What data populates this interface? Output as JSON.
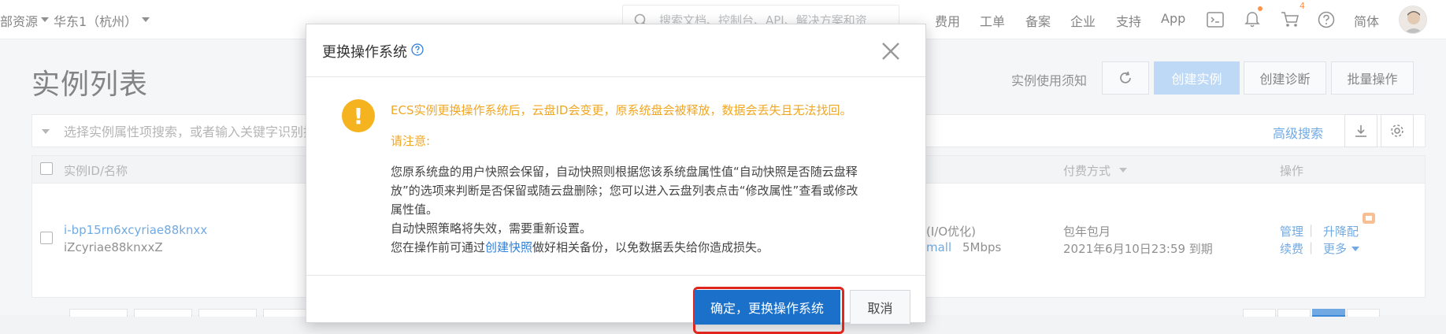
{
  "topbar": {
    "resource_label": "部资源",
    "region_label": "华东1（杭州）",
    "search_placeholder": "搜索文档、控制台、API、解决方案和资",
    "nav": [
      "费用",
      "工单",
      "备案",
      "企业",
      "支持",
      "App"
    ],
    "cart_badge": "4",
    "language": "简体"
  },
  "page": {
    "title": "实例列表",
    "usage_notice": "实例使用须知",
    "create_instance": "创建实例",
    "create_diagnosis": "创建诊断",
    "batch_operation": "批量操作",
    "filter_placeholder": "选择实例属性项搜索，或者输入关键字识别搜",
    "advanced_search": "高级搜索"
  },
  "table": {
    "headers": {
      "instance": "实例ID/名称",
      "billing": "付费方式",
      "actions": "操作"
    },
    "row": {
      "instance_id": "i-bp15rn6xcyriae88knxx",
      "instance_name": "iZcyriae88knxxZ",
      "disk_type": "(I/O优化)",
      "spec_suffix": "mall",
      "bandwidth": "5Mbps",
      "billing_type": "包年包月",
      "expiry": "2021年6月10日23:59 到期",
      "manage": "管理",
      "upgrade": "升降配",
      "renew": "续费",
      "more": "更多"
    }
  },
  "modal": {
    "title": "更换操作系统",
    "warning": "ECS实例更换操作系统后，云盘ID会变更，原系统盘会被释放，数据会丢失且无法找回。",
    "notice_label": "请注意:",
    "line1": "您原系统盘的用户快照会保留，自动快照则根据您该系统盘属性值“自动快照是否随云盘释",
    "line2": "放”的选项来判断是否保留或随云盘删除；您可以进入云盘列表点击“修改属性”查看或修改",
    "line3": "属性值。",
    "line4": "自动快照策略将失效，需要重新设置。",
    "line5_pre": "您在操作前可通过",
    "line5_link": "创建快照",
    "line5_post": "做好相关备份，以免数据丢失给你造成损失。",
    "confirm": "确定，更换操作系统",
    "cancel": "取消"
  },
  "colors": {
    "primary": "#1b70c9",
    "warning": "#f0a722",
    "link": "#3b8ad9",
    "highlight": "#e0261c"
  }
}
